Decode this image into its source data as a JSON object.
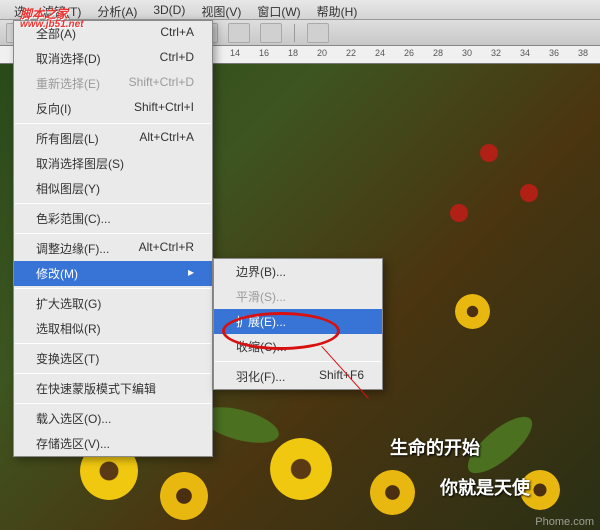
{
  "menubar": [
    "选",
    "滤镜(T)",
    "分析(A)",
    "3D(D)",
    "视图(V)",
    "窗口(W)",
    "帮助(H)"
  ],
  "ruler": [
    "14",
    "16",
    "18",
    "20",
    "22",
    "24",
    "26",
    "28",
    "30",
    "32",
    "34",
    "36",
    "38"
  ],
  "dropdown": {
    "items": [
      {
        "label": "全部(A)",
        "shortcut": "Ctrl+A",
        "state": "normal"
      },
      {
        "label": "取消选择(D)",
        "shortcut": "Ctrl+D",
        "state": "normal"
      },
      {
        "label": "重新选择(E)",
        "shortcut": "Shift+Ctrl+D",
        "state": "disabled"
      },
      {
        "label": "反向(I)",
        "shortcut": "Shift+Ctrl+I",
        "state": "normal"
      },
      {
        "sep": true
      },
      {
        "label": "所有图层(L)",
        "shortcut": "Alt+Ctrl+A",
        "state": "normal"
      },
      {
        "label": "取消选择图层(S)",
        "shortcut": "",
        "state": "normal"
      },
      {
        "label": "相似图层(Y)",
        "shortcut": "",
        "state": "normal"
      },
      {
        "sep": true
      },
      {
        "label": "色彩范围(C)...",
        "shortcut": "",
        "state": "normal"
      },
      {
        "sep": true
      },
      {
        "label": "调整边缘(F)...",
        "shortcut": "Alt+Ctrl+R",
        "state": "normal"
      },
      {
        "label": "修改(M)",
        "shortcut": "",
        "state": "hl",
        "arrow": true
      },
      {
        "sep": true
      },
      {
        "label": "扩大选取(G)",
        "shortcut": "",
        "state": "normal"
      },
      {
        "label": "选取相似(R)",
        "shortcut": "",
        "state": "normal"
      },
      {
        "sep": true
      },
      {
        "label": "变换选区(T)",
        "shortcut": "",
        "state": "normal"
      },
      {
        "sep": true
      },
      {
        "label": "在快速蒙版模式下编辑",
        "shortcut": "",
        "state": "normal"
      },
      {
        "sep": true
      },
      {
        "label": "载入选区(O)...",
        "shortcut": "",
        "state": "normal"
      },
      {
        "label": "存储选区(V)...",
        "shortcut": "",
        "state": "normal"
      }
    ]
  },
  "submenu": {
    "items": [
      {
        "label": "边界(B)...",
        "shortcut": "",
        "state": "normal"
      },
      {
        "label": "平滑(S)...",
        "shortcut": "",
        "state": "disabled"
      },
      {
        "label": "扩展(E)...",
        "shortcut": "",
        "state": "hl"
      },
      {
        "label": "收缩(C)...",
        "shortcut": "",
        "state": "normal"
      },
      {
        "sep": true
      },
      {
        "label": "羽化(F)...",
        "shortcut": "Shift+F6",
        "state": "normal"
      }
    ]
  },
  "captions": {
    "line1": "生命的开始",
    "line2": "你就是天使"
  },
  "watermark": {
    "title": "脚本之家",
    "sub": "www.jb51.net"
  },
  "pmark": "Phome.com"
}
